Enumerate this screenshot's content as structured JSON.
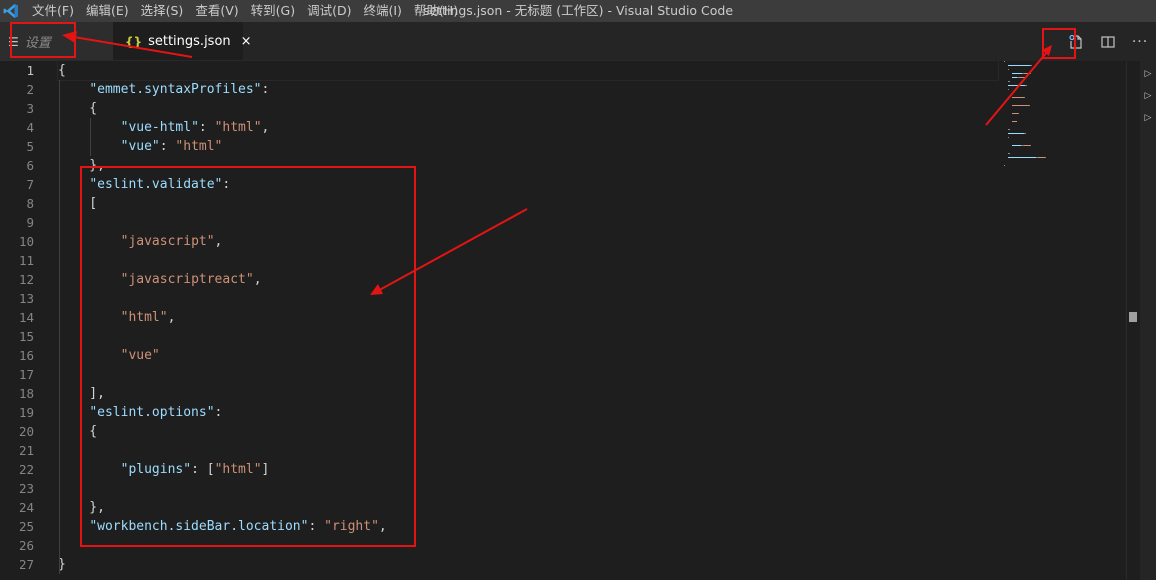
{
  "titlebar": {
    "menu": [
      "文件(F)",
      "编辑(E)",
      "选择(S)",
      "查看(V)",
      "转到(G)",
      "调试(D)",
      "终端(I)",
      "帮助(H)"
    ],
    "window_title": "settings.json - 无标题 (工作区) - Visual Studio Code"
  },
  "tabs": [
    {
      "label": "设置",
      "icon": "settings-list-icon",
      "active": false,
      "italic": true
    },
    {
      "label": "settings.json",
      "icon": "json-braces-icon",
      "active": true,
      "close": "×"
    }
  ],
  "editor_actions": [
    "open-settings-icon",
    "split-editor-icon",
    "more-actions-icon"
  ],
  "editor": {
    "active_line": 1,
    "line_numbers": [
      "1",
      "2",
      "3",
      "4",
      "5",
      "6",
      "7",
      "8",
      "9",
      "10",
      "11",
      "12",
      "13",
      "14",
      "15",
      "16",
      "17",
      "18",
      "19",
      "20",
      "21",
      "22",
      "23",
      "24",
      "25",
      "26",
      "27"
    ],
    "lines": [
      [
        {
          "t": "p",
          "v": "{"
        }
      ],
      [
        {
          "t": "p",
          "v": "    "
        },
        {
          "t": "k",
          "v": "\"emmet.syntaxProfiles\""
        },
        {
          "t": "p",
          "v": ": "
        }
      ],
      [
        {
          "t": "p",
          "v": "    {"
        }
      ],
      [
        {
          "t": "p",
          "v": "        "
        },
        {
          "t": "k",
          "v": "\"vue-html\""
        },
        {
          "t": "p",
          "v": ": "
        },
        {
          "t": "s",
          "v": "\"html\""
        },
        {
          "t": "p",
          "v": ","
        }
      ],
      [
        {
          "t": "p",
          "v": "        "
        },
        {
          "t": "k",
          "v": "\"vue\""
        },
        {
          "t": "p",
          "v": ": "
        },
        {
          "t": "s",
          "v": "\"html\""
        }
      ],
      [
        {
          "t": "p",
          "v": "    },"
        }
      ],
      [
        {
          "t": "p",
          "v": "    "
        },
        {
          "t": "k",
          "v": "\"eslint.validate\""
        },
        {
          "t": "p",
          "v": ": "
        }
      ],
      [
        {
          "t": "p",
          "v": "    ["
        }
      ],
      [
        {
          "t": "p",
          "v": ""
        }
      ],
      [
        {
          "t": "p",
          "v": "        "
        },
        {
          "t": "s",
          "v": "\"javascript\""
        },
        {
          "t": "p",
          "v": ","
        }
      ],
      [
        {
          "t": "p",
          "v": ""
        }
      ],
      [
        {
          "t": "p",
          "v": "        "
        },
        {
          "t": "s",
          "v": "\"javascriptreact\""
        },
        {
          "t": "p",
          "v": ","
        }
      ],
      [
        {
          "t": "p",
          "v": ""
        }
      ],
      [
        {
          "t": "p",
          "v": "        "
        },
        {
          "t": "s",
          "v": "\"html\""
        },
        {
          "t": "p",
          "v": ","
        }
      ],
      [
        {
          "t": "p",
          "v": ""
        }
      ],
      [
        {
          "t": "p",
          "v": "        "
        },
        {
          "t": "s",
          "v": "\"vue\""
        }
      ],
      [
        {
          "t": "p",
          "v": ""
        }
      ],
      [
        {
          "t": "p",
          "v": "    ],"
        }
      ],
      [
        {
          "t": "p",
          "v": "    "
        },
        {
          "t": "k",
          "v": "\"eslint.options\""
        },
        {
          "t": "p",
          "v": ": "
        }
      ],
      [
        {
          "t": "p",
          "v": "    {"
        }
      ],
      [
        {
          "t": "p",
          "v": ""
        }
      ],
      [
        {
          "t": "p",
          "v": "        "
        },
        {
          "t": "k",
          "v": "\"plugins\""
        },
        {
          "t": "p",
          "v": ": ["
        },
        {
          "t": "s",
          "v": "\"html\""
        },
        {
          "t": "p",
          "v": "]"
        }
      ],
      [
        {
          "t": "p",
          "v": ""
        }
      ],
      [
        {
          "t": "p",
          "v": "    },"
        }
      ],
      [
        {
          "t": "p",
          "v": "    "
        },
        {
          "t": "k",
          "v": "\"workbench.sideBar.location\""
        },
        {
          "t": "p",
          "v": ": "
        },
        {
          "t": "s",
          "v": "\"right\""
        },
        {
          "t": "p",
          "v": ","
        }
      ],
      [
        {
          "t": "p",
          "v": ""
        }
      ],
      [
        {
          "t": "p",
          "v": "}"
        }
      ]
    ]
  },
  "colors": {
    "key": "#9cdcfe",
    "string": "#ce9178",
    "punctuation": "#d4d4d4",
    "annotation": "#e51414",
    "titlebar": "#3c3c3c",
    "editor_bg": "#1e1e1e"
  }
}
